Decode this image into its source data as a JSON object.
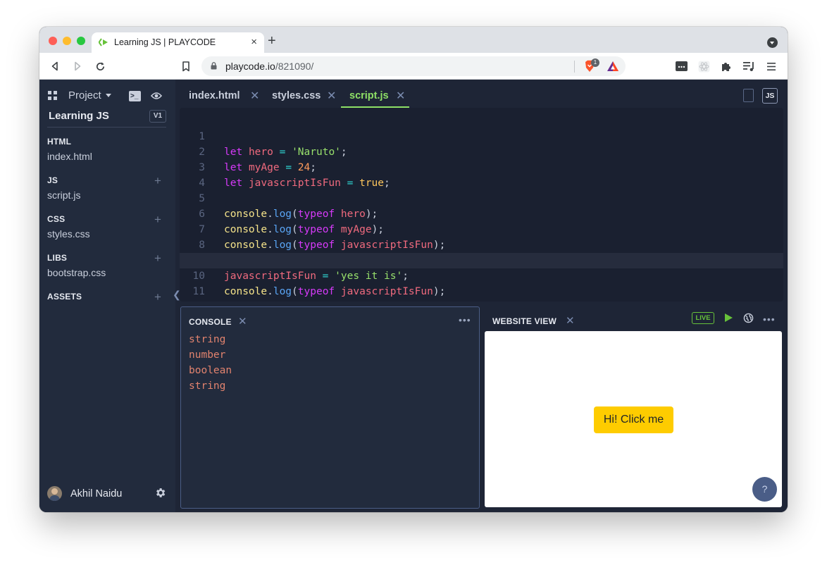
{
  "browser": {
    "tab_title": "Learning JS | PLAYCODE",
    "tab_close": "×",
    "new_tab": "+",
    "url_host": "playcode.io",
    "url_path": "/821090/",
    "brave_badge_count": "1"
  },
  "sidebar": {
    "project_menu_label": "Project",
    "project_title": "Learning JS",
    "version_badge": "V1",
    "sections": [
      {
        "label": "HTML",
        "file": "index.html",
        "add": ""
      },
      {
        "label": "JS",
        "file": "script.js",
        "add": "+"
      },
      {
        "label": "CSS",
        "file": "styles.css",
        "add": "+"
      },
      {
        "label": "LIBS",
        "file": "bootstrap.css",
        "add": "+"
      },
      {
        "label": "ASSETS",
        "file": "",
        "add": "+"
      }
    ],
    "collapse_glyph": "❮",
    "user_name": "Akhil Naidu"
  },
  "editor": {
    "tabs": [
      {
        "label": "index.html",
        "close": "✕"
      },
      {
        "label": "styles.css",
        "close": "✕"
      },
      {
        "label": "script.js",
        "close": "✕"
      }
    ],
    "active_tab": "script.js",
    "language_badge": "JS",
    "line_numbers": [
      "1",
      "2",
      "3",
      "4",
      "5",
      "6",
      "7",
      "8",
      "9",
      "10",
      "11"
    ],
    "active_line": 10,
    "tokens": {
      "let": "let",
      "eq": " = ",
      "semi": ";",
      "hero": "hero",
      "myAge": "myAge",
      "javascriptIsFun": "javascriptIsFun",
      "naruto": "'Naruto'",
      "age": "24",
      "true": "true",
      "console": "console",
      "dot": ".",
      "log": "log",
      "open": "(",
      "close": ");",
      "typeof": "typeof",
      "yes": "'yes it is'"
    }
  },
  "console": {
    "title": "CONSOLE",
    "close": "✕",
    "menu": "•••",
    "lines": [
      "string",
      "number",
      "boolean",
      "string"
    ]
  },
  "website_view": {
    "title": "WEBSITE VIEW",
    "close": "✕",
    "live_badge": "LIVE",
    "menu": "•••",
    "button_label": "Hi! Click me",
    "help_label": "?"
  },
  "colors": {
    "app_bg": "#1e2536",
    "sidebar_bg": "#222b3d",
    "accent_green": "#8ee066",
    "live_green": "#67c23a",
    "preview_button": "#fecc00"
  }
}
